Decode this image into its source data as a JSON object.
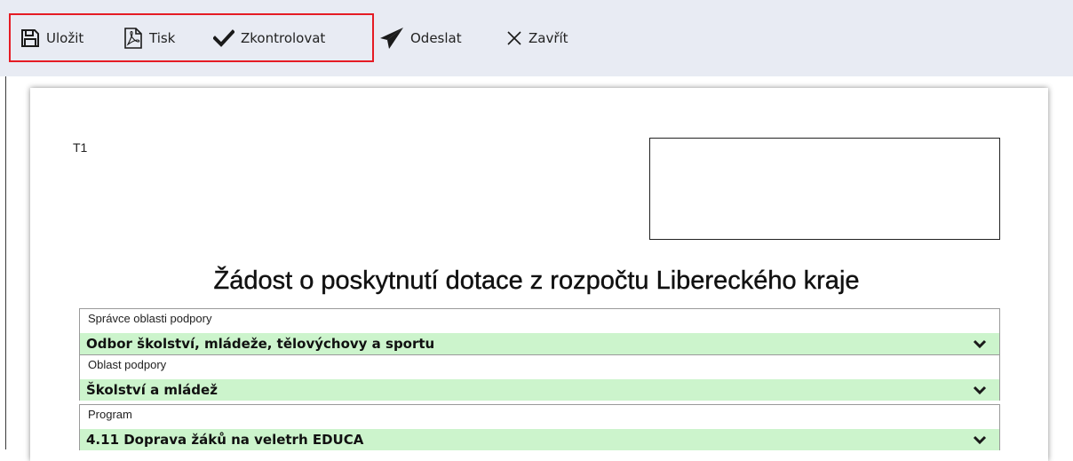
{
  "toolbar": {
    "save_label": "Uložit",
    "print_label": "Tisk",
    "check_label": "Zkontrolovat",
    "send_label": "Odeslat",
    "close_label": "Zavřít",
    "icons": [
      "save-icon",
      "pdf-icon",
      "checkmark-icon",
      "paper-plane-icon",
      "close-icon"
    ],
    "highlight_color": "#e51b24"
  },
  "document": {
    "form_code": "T1",
    "title": "Žádost o poskytnutí dotace z rozpočtu Libereckého kraje",
    "fields": [
      {
        "label": "Správce oblasti podpory",
        "value": "Odbor školství, mládeže, tělovýchovy a sportu"
      },
      {
        "label": "Oblast podpory",
        "value": "Školství a mládež"
      },
      {
        "label": "Program",
        "value": "4.11 Doprava žáků na veletrh EDUCA"
      }
    ],
    "field_bg_color": "#ccf4cc"
  }
}
